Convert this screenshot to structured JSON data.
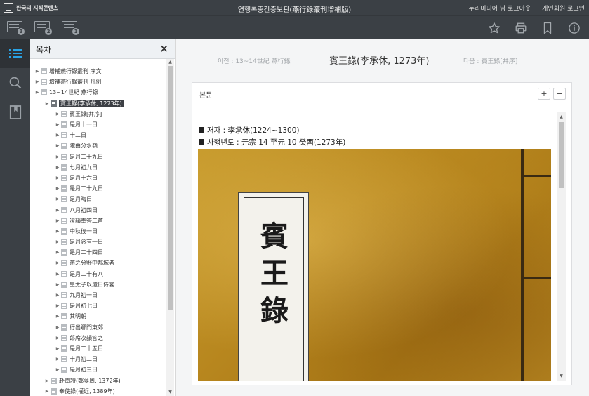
{
  "header": {
    "logo_text": "한국의 지식콘텐츠",
    "title": "연행록총간증보판(燕行錄叢刊增補版)",
    "user_login": "누리미디어 님 로그아웃",
    "personal_login": "개인회원 로그인"
  },
  "toolbar": {
    "layout_buttons": [
      {
        "name": "layout-3",
        "badge": "3"
      },
      {
        "name": "layout-2",
        "badge": "2"
      },
      {
        "name": "layout-1",
        "badge": "1"
      }
    ],
    "right_icons": [
      "star-icon",
      "print-icon",
      "bookmark-icon",
      "info-icon"
    ]
  },
  "rail": [
    "list-icon",
    "search-icon",
    "bookmark-icon"
  ],
  "toc": {
    "title": "목차",
    "close": "×",
    "items": [
      {
        "label": "增補燕行錄叢刊 序文",
        "level": 0,
        "selected": false
      },
      {
        "label": "增補燕行錄叢刊 凡例",
        "level": 0,
        "selected": false
      },
      {
        "label": "13~14世紀 燕行錄",
        "level": 0,
        "selected": false
      },
      {
        "label": "賓王錄(李承休, 1273年)",
        "level": 1,
        "selected": true
      },
      {
        "label": "賓王錄[幷序]",
        "level": 2,
        "selected": false
      },
      {
        "label": "是月十一日",
        "level": 2,
        "selected": false
      },
      {
        "label": "十二日",
        "level": 2,
        "selected": false
      },
      {
        "label": "隴由分水嶺",
        "level": 2,
        "selected": false
      },
      {
        "label": "是月二十九日",
        "level": 2,
        "selected": false
      },
      {
        "label": "七月初九日",
        "level": 2,
        "selected": false
      },
      {
        "label": "是月十六日",
        "level": 2,
        "selected": false
      },
      {
        "label": "是月二十九日",
        "level": 2,
        "selected": false
      },
      {
        "label": "是月晦日",
        "level": 2,
        "selected": false
      },
      {
        "label": "八月初四日",
        "level": 2,
        "selected": false
      },
      {
        "label": "次韻奉答二首",
        "level": 2,
        "selected": false
      },
      {
        "label": "中秋後一日",
        "level": 2,
        "selected": false
      },
      {
        "label": "是月念有一日",
        "level": 2,
        "selected": false
      },
      {
        "label": "是月二十四日",
        "level": 2,
        "selected": false
      },
      {
        "label": "燕之分野中都城者",
        "level": 2,
        "selected": false
      },
      {
        "label": "是月二十有八",
        "level": 2,
        "selected": false
      },
      {
        "label": "皇太子以還日侍宴",
        "level": 2,
        "selected": false
      },
      {
        "label": "九月初一日",
        "level": 2,
        "selected": false
      },
      {
        "label": "是月初七日",
        "level": 2,
        "selected": false
      },
      {
        "label": "其明朝",
        "level": 2,
        "selected": false
      },
      {
        "label": "行出鄂門東郊",
        "level": 2,
        "selected": false
      },
      {
        "label": "郎席次韻答之",
        "level": 2,
        "selected": false
      },
      {
        "label": "是月二十五日",
        "level": 2,
        "selected": false
      },
      {
        "label": "十月初二日",
        "level": 2,
        "selected": false
      },
      {
        "label": "是月初三日",
        "level": 2,
        "selected": false
      },
      {
        "label": "赴南詩(鄭夢周, 1372年)",
        "level": 1,
        "selected": false
      },
      {
        "label": "奉使錄(權近, 1389年)",
        "level": 1,
        "selected": false
      }
    ]
  },
  "nav": {
    "prev": "이전 : 13~14世紀 燕行錄",
    "current": "賓王錄(李承休, 1273年)",
    "next": "다음 : 賓王錄[幷序]"
  },
  "panel": {
    "title": "본문",
    "zoom_in": "+",
    "zoom_out": "−",
    "author_line": "저자 : 李承休(1224~1300)",
    "year_line": "사행년도 : 元宗 14 至元 10 癸酉(1273年)",
    "book_label": [
      "賓",
      "王",
      "錄"
    ]
  }
}
